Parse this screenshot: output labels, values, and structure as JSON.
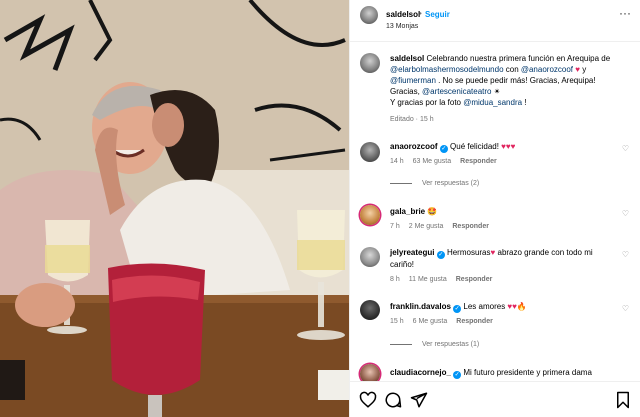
{
  "post": {
    "owner": "saldelsol",
    "follow_label": "Seguir",
    "dot": "•",
    "location": "13 Monjas",
    "more_icon": "more-horizontal-icon"
  },
  "caption": {
    "username": "saldelsol",
    "text_1": " Celebrando nuestra primera función en Arequipa de",
    "mention_1": "@elarbolmashermosodelmundo",
    "text_2": " con ",
    "mention_2": "@anaorozcoof",
    "text_3": " y",
    "mention_3": "@fiumerman",
    "text_4": " . No se puede pedir más! Gracias, Arequipa!",
    "text_5": "Gracias, ",
    "mention_4": "@artescenicateatro",
    "text_6": "Y gracias por la foto ",
    "mention_5": "@midua_sandra",
    "text_7": " !",
    "meta": "Editado · 15 h"
  },
  "comments": [
    {
      "username": "anaorozcoof",
      "verified": true,
      "text": "Qué felicidad! ",
      "emojis": "♥♥♥",
      "time": "14 h",
      "likes": "63 Me gusta",
      "reply": "Responder",
      "replies": "Ver respuestas (2)"
    },
    {
      "username": "gala_brie",
      "verified": false,
      "text": "",
      "emojis": "🤩",
      "time": "7 h",
      "likes": "2 Me gusta",
      "reply": "Responder"
    },
    {
      "username": "jelyreategui",
      "verified": true,
      "text": "Hermosuras",
      "emojis": "♥",
      "text_b": " abrazo grande con todo mi",
      "text_c": "cariño!",
      "time": "8 h",
      "likes": "11 Me gusta",
      "reply": "Responder"
    },
    {
      "username": "franklin.davalos",
      "verified": true,
      "text": "Les amores ",
      "emojis": "♥♥🔥",
      "time": "15 h",
      "likes": "6 Me gusta",
      "reply": "Responder",
      "replies": "Ver respuestas (1)"
    },
    {
      "username": "claudiacornejo_",
      "verified": true,
      "text": "Mi futuro presidente y primera dama",
      "emojis": "",
      "time": "",
      "likes": "",
      "reply": ""
    }
  ],
  "colors": {
    "link": "#00376b",
    "accent": "#0095f6",
    "muted": "#737373",
    "heart": "#e0245e"
  }
}
